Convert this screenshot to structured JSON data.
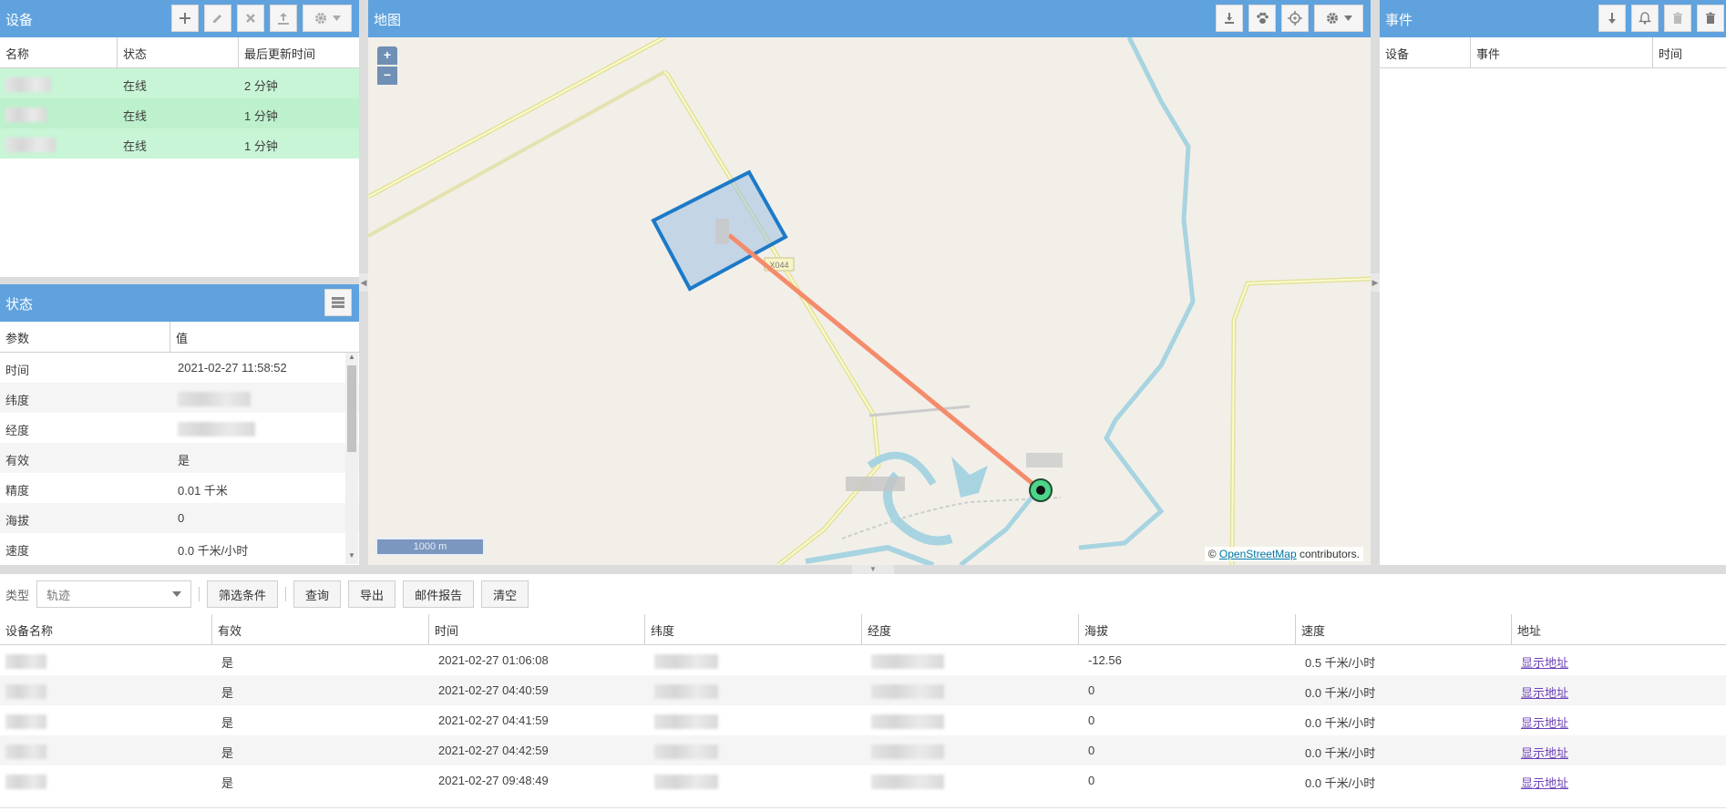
{
  "devices": {
    "title": "设备",
    "columns": [
      "名称",
      "状态",
      "最后更新时间"
    ],
    "rows": [
      {
        "status": "在线",
        "updated": "2 分钟"
      },
      {
        "status": "在线",
        "updated": "1 分钟"
      },
      {
        "status": "在线",
        "updated": "1 分钟"
      }
    ]
  },
  "state": {
    "title": "状态",
    "columns": [
      "参数",
      "值"
    ],
    "rows": [
      {
        "param": "时间",
        "value": "2021-02-27 11:58:52"
      },
      {
        "param": "纬度",
        "value": ""
      },
      {
        "param": "经度",
        "value": ""
      },
      {
        "param": "有效",
        "value": "是"
      },
      {
        "param": "精度",
        "value": "0.01 千米"
      },
      {
        "param": "海拔",
        "value": "0"
      },
      {
        "param": "速度",
        "value": "0.0 千米/小时"
      }
    ]
  },
  "map": {
    "title": "地图",
    "zoom_in": "+",
    "zoom_out": "−",
    "scale_label": "1000 m",
    "road_label": "X044",
    "attribution_prefix": "© ",
    "attribution_link": "OpenStreetMap",
    "attribution_suffix": " contributors."
  },
  "events": {
    "title": "事件",
    "columns": [
      "设备",
      "事件",
      "时间"
    ]
  },
  "report": {
    "type_label": "类型",
    "type_value": "轨迹",
    "buttons": {
      "filter": "筛选条件",
      "query": "查询",
      "export": "导出",
      "email": "邮件报告",
      "clear": "清空"
    },
    "columns": [
      "设备名称",
      "有效",
      "时间",
      "纬度",
      "经度",
      "海拔",
      "速度",
      "地址"
    ],
    "rows": [
      {
        "valid": "是",
        "time": "2021-02-27 01:06:08",
        "altitude": "-12.56",
        "speed": "0.5 千米/小时",
        "address": "显示地址"
      },
      {
        "valid": "是",
        "time": "2021-02-27 04:40:59",
        "altitude": "0",
        "speed": "0.0 千米/小时",
        "address": "显示地址"
      },
      {
        "valid": "是",
        "time": "2021-02-27 04:41:59",
        "altitude": "0",
        "speed": "0.0 千米/小时",
        "address": "显示地址"
      },
      {
        "valid": "是",
        "time": "2021-02-27 04:42:59",
        "altitude": "0",
        "speed": "0.0 千米/小时",
        "address": "显示地址"
      },
      {
        "valid": "是",
        "time": "2021-02-27 09:48:49",
        "altitude": "0",
        "speed": "0.0 千米/小时",
        "address": "显示地址"
      }
    ]
  }
}
